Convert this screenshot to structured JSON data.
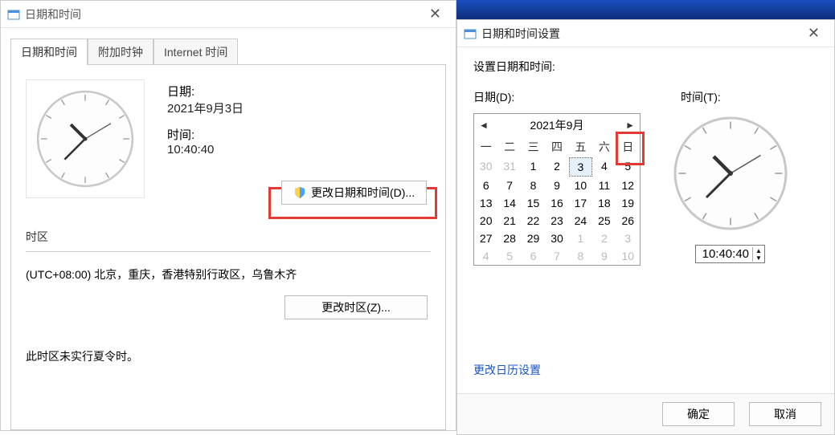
{
  "win1": {
    "title": "日期和时间",
    "tabs": [
      "日期和时间",
      "附加时钟",
      "Internet 时间"
    ],
    "date_label": "日期:",
    "date_value": "2021年9月3日",
    "time_label": "时间:",
    "time_value": "10:40:40",
    "change_dt_btn": "更改日期和时间(D)...",
    "tz_section": "时区",
    "tz_value": "(UTC+08:00) 北京，重庆，香港特别行政区，乌鲁木齐",
    "change_tz_btn": "更改时区(Z)...",
    "dst_note": "此时区未实行夏令时。"
  },
  "win2": {
    "title": "日期和时间设置",
    "header": "设置日期和时间:",
    "date_label": "日期(D):",
    "time_label": "时间(T):",
    "month_title": "2021年9月",
    "dow": [
      "一",
      "二",
      "三",
      "四",
      "五",
      "六",
      "日"
    ],
    "weeks": [
      [
        {
          "n": 30,
          "o": true
        },
        {
          "n": 31,
          "o": true
        },
        {
          "n": 1
        },
        {
          "n": 2
        },
        {
          "n": 3,
          "sel": true
        },
        {
          "n": 4
        },
        {
          "n": 5
        }
      ],
      [
        {
          "n": 6
        },
        {
          "n": 7
        },
        {
          "n": 8
        },
        {
          "n": 9
        },
        {
          "n": 10
        },
        {
          "n": 11
        },
        {
          "n": 12
        }
      ],
      [
        {
          "n": 13
        },
        {
          "n": 14
        },
        {
          "n": 15
        },
        {
          "n": 16
        },
        {
          "n": 17
        },
        {
          "n": 18
        },
        {
          "n": 19
        }
      ],
      [
        {
          "n": 20
        },
        {
          "n": 21
        },
        {
          "n": 22
        },
        {
          "n": 23
        },
        {
          "n": 24
        },
        {
          "n": 25
        },
        {
          "n": 26
        }
      ],
      [
        {
          "n": 27
        },
        {
          "n": 28
        },
        {
          "n": 29
        },
        {
          "n": 30
        },
        {
          "n": 1,
          "o": true
        },
        {
          "n": 2,
          "o": true
        },
        {
          "n": 3,
          "o": true
        }
      ],
      [
        {
          "n": 4,
          "o": true
        },
        {
          "n": 5,
          "o": true
        },
        {
          "n": 6,
          "o": true
        },
        {
          "n": 7,
          "o": true
        },
        {
          "n": 8,
          "o": true
        },
        {
          "n": 9,
          "o": true
        },
        {
          "n": 10,
          "o": true
        }
      ]
    ],
    "time_value": "10:40:40",
    "calendar_link": "更改日历设置",
    "ok_btn": "确定",
    "cancel_btn": "取消"
  }
}
